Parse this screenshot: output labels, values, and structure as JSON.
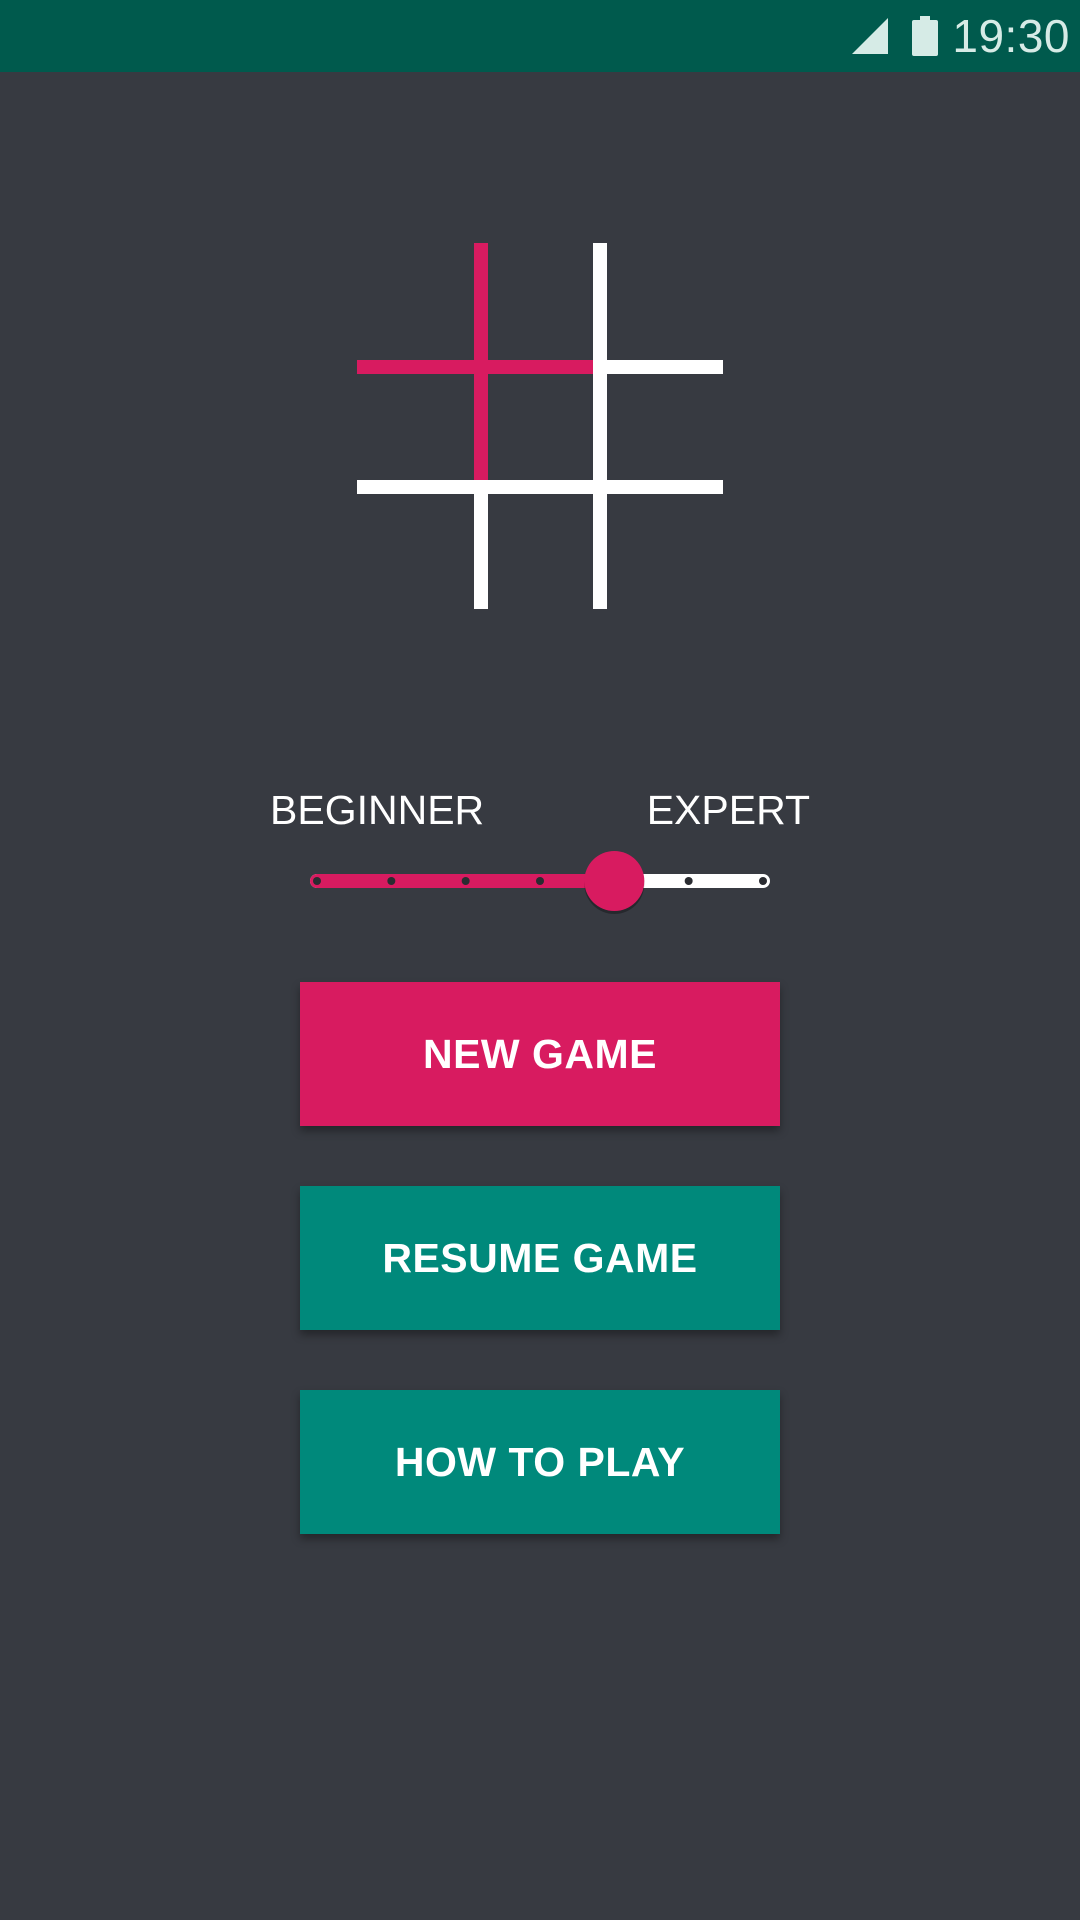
{
  "status_bar": {
    "time": "19:30",
    "signal_icon": "cellular-signal-icon",
    "battery_icon": "battery-icon",
    "background": "#005a4d"
  },
  "logo": {
    "icon": "tic-tac-toe-grid-icon",
    "highlight_color": "#d81b60",
    "line_color": "#ffffff"
  },
  "difficulty": {
    "min_label": "BEGINNER",
    "max_label": "EXPERT",
    "steps": 7,
    "selected_step": 4,
    "active_color": "#d81b60",
    "inactive_color": "#ffffff"
  },
  "buttons": {
    "new_game": "NEW GAME",
    "resume_game": "RESUME GAME",
    "how_to_play": "HOW TO PLAY"
  },
  "colors": {
    "background": "#373a41",
    "accent": "#d81b60",
    "teal": "#00897b"
  }
}
